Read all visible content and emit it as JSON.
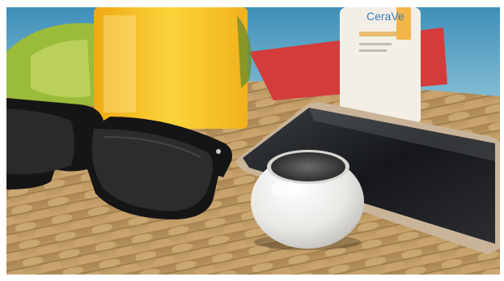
{
  "scene": {
    "description_hidden": "",
    "brand_text": "CeraVe",
    "colors": {
      "pool": "#5fa2c4",
      "mat": "#b58d5a",
      "drink": "#f7c21b",
      "lime": "#9bbb3a",
      "glasses": "#151515",
      "speaker": "#ecebe8",
      "grille": "#4a4a4a",
      "phone_screen": "#1d1f22",
      "phone_frame": "#c9b49a",
      "sunscreen": "#f3efe6",
      "towel": "#d43b3b"
    }
  }
}
